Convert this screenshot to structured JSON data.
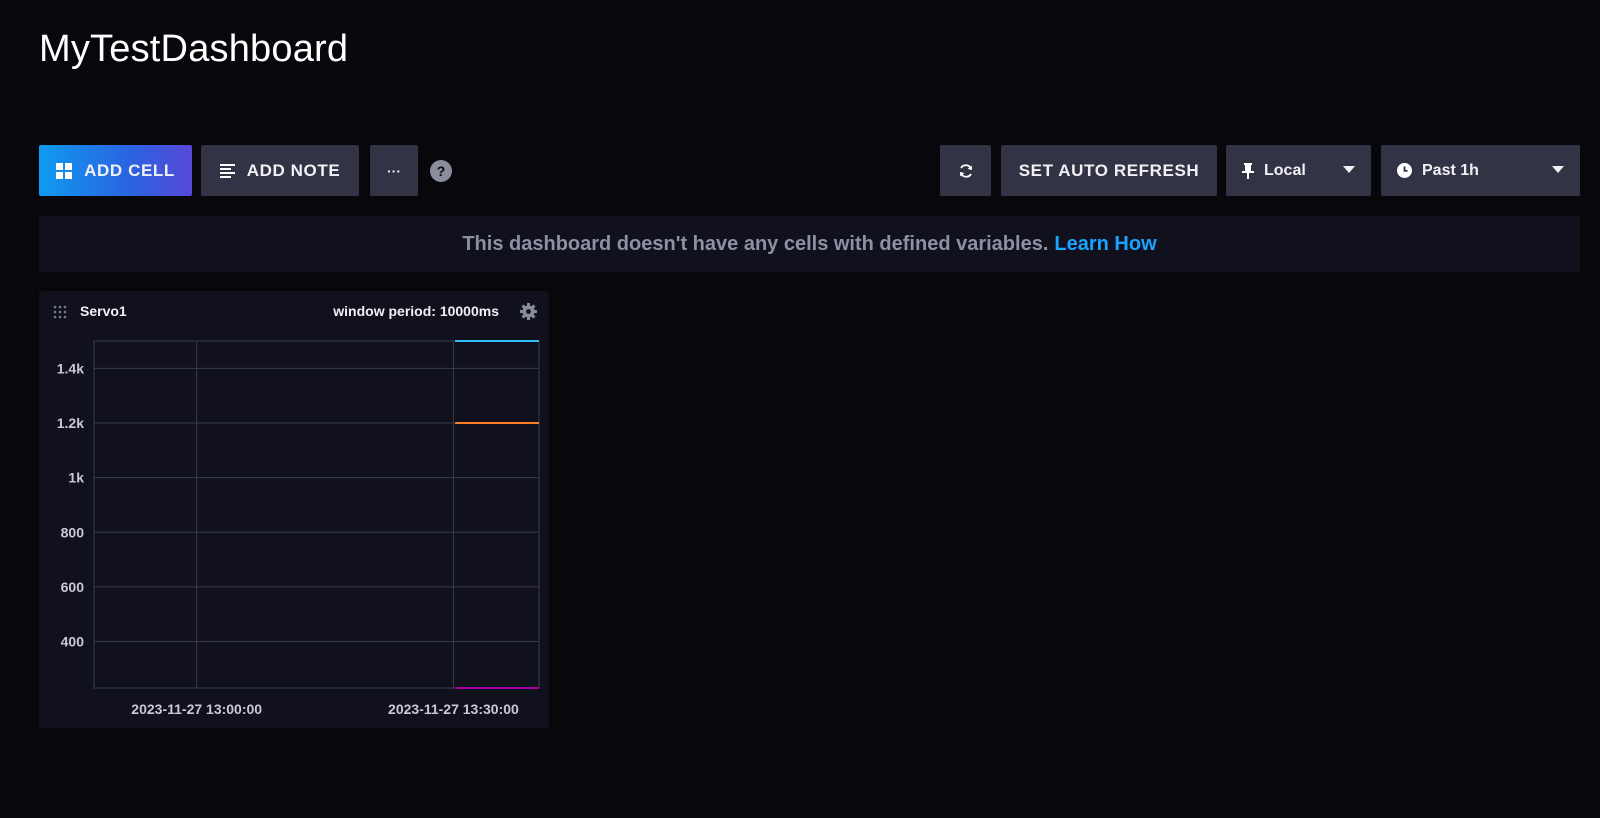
{
  "dashboard": {
    "title": "MyTestDashboard"
  },
  "toolbar": {
    "add_cell_label": "ADD CELL",
    "add_note_label": "ADD NOTE",
    "more_label": "···",
    "auto_refresh_label": "SET AUTO REFRESH",
    "timezone_label": "Local",
    "time_range_label": "Past 1h",
    "icons": {
      "add_cell": "grid-icon",
      "add_note": "lines-icon",
      "help": "question-circle-icon",
      "refresh": "refresh-icon",
      "timezone": "pin-icon",
      "time_range": "clock-icon"
    }
  },
  "banner": {
    "message": "This dashboard doesn't have any cells with defined variables.",
    "link_text": "Learn How"
  },
  "cell": {
    "name": "Servo1",
    "window_period": "window period: 10000ms",
    "chart_data": {
      "type": "line",
      "x_tick_labels": [
        "2023-11-27 13:00:00",
        "2023-11-27 13:30:00"
      ],
      "y_tick_labels": [
        "400",
        "600",
        "800",
        "1k",
        "1.2k",
        "1.4k"
      ],
      "y_ticks": [
        400,
        600,
        800,
        1000,
        1200,
        1400
      ],
      "ylim": [
        230,
        1500
      ],
      "x_range_minutes": [
        -12,
        40
      ],
      "x_tick_minutes": [
        0,
        30
      ],
      "grid": true,
      "series": [
        {
          "color": "#31c0f6",
          "x_start_minutes": 30.2,
          "x_end_minutes": 40,
          "y": 1500
        },
        {
          "color": "#ff7e27",
          "x_start_minutes": 30.2,
          "x_end_minutes": 40,
          "y": 1200
        },
        {
          "color": "#a500a5",
          "x_start_minutes": 30.2,
          "x_end_minutes": 40,
          "y": 230
        }
      ]
    }
  }
}
